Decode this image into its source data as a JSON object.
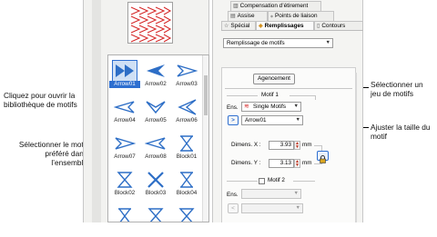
{
  "callouts": {
    "open_library": "Cliquez pour ouvrir la bibliothèque de motifs",
    "select_motif": "Sélectionner le motif préféré dans l’ensemble",
    "select_set": "Sélectionner un jeu de motifs",
    "adjust_size": "Ajuster la taille du motif"
  },
  "library": {
    "motifs": [
      {
        "name": "Arrow01",
        "icon": "arrow-double-right-icon",
        "selected": true
      },
      {
        "name": "Arrow02",
        "icon": "arrow-left-filled-icon"
      },
      {
        "name": "Arrow03",
        "icon": "arrow-outline-right-icon"
      },
      {
        "name": "Arrow04",
        "icon": "arrow-outline-left-icon"
      },
      {
        "name": "Arrow05",
        "icon": "chevron-down-outline-icon"
      },
      {
        "name": "Arrow06",
        "icon": "chevron-left-outline-icon"
      },
      {
        "name": "Arrow07",
        "icon": "arrow-outline-right-icon"
      },
      {
        "name": "Arrow08",
        "icon": "arrow-outline-left-icon"
      },
      {
        "name": "Block01",
        "icon": "x-bowtie-icon"
      },
      {
        "name": "Block02",
        "icon": "hourglass-icon"
      },
      {
        "name": "Block03",
        "icon": "x-cross-icon"
      },
      {
        "name": "Block04",
        "icon": "x-bowtie-icon"
      },
      {
        "name": "",
        "icon": "x-bowtie-icon"
      },
      {
        "name": "",
        "icon": "hourglass-icon"
      },
      {
        "name": "",
        "icon": "hourglass-icon"
      }
    ]
  },
  "tabs": {
    "compensation": "Compensation d’étirement",
    "assise": "Assise",
    "points_liaison": "Points de liaison",
    "special": "Spécial",
    "remplissages": "Remplissages",
    "contours": "Contours"
  },
  "fill_type": {
    "value": "Remplissage de motifs"
  },
  "layout_button": "Agencement",
  "motif1": {
    "title": "Motif 1",
    "ens_label": "Ens.",
    "ens_value": "Single Motifs",
    "open_button": ">",
    "motif_value": "Arrow01",
    "dimx_label": "Dimens. X :",
    "dimx_value": "3.93",
    "dimy_label": "Dimens. Y :",
    "dimy_value": "3.13",
    "unit": "mm"
  },
  "motif2": {
    "title": "Motif 2",
    "ens_label": "Ens.",
    "open_button": "<"
  }
}
